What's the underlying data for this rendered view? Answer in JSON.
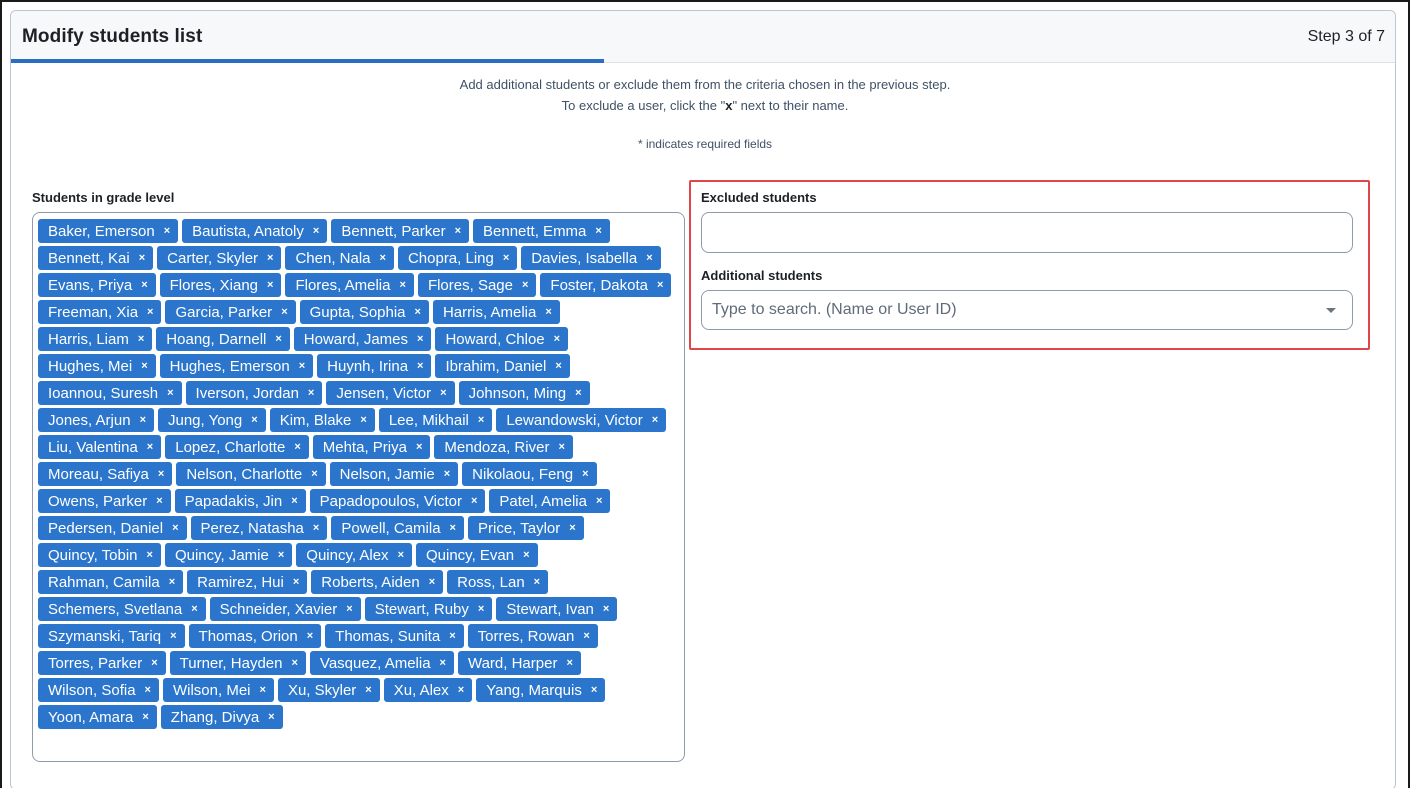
{
  "header": {
    "title": "Modify students list",
    "step": "Step 3 of 7"
  },
  "intro": {
    "line1": "Add additional students or exclude them from the criteria chosen in the previous step.",
    "line2_prefix": "To exclude a user, click the \"",
    "line2_bold": "x",
    "line2_suffix": "\" next to their name.",
    "required_note": "* indicates required fields"
  },
  "grade_level": {
    "label": "Students in grade level",
    "remove_symbol": "×",
    "students": [
      "Baker, Emerson",
      "Bautista, Anatoly",
      "Bennett, Parker",
      "Bennett, Emma",
      "Bennett, Kai",
      "Carter, Skyler",
      "Chen, Nala",
      "Chopra, Ling",
      "Davies, Isabella",
      "Evans, Priya",
      "Flores, Xiang",
      "Flores, Amelia",
      "Flores, Sage",
      "Foster, Dakota",
      "Freeman, Xia",
      "Garcia, Parker",
      "Gupta, Sophia",
      "Harris, Amelia",
      "Harris, Liam",
      "Hoang, Darnell",
      "Howard, James",
      "Howard, Chloe",
      "Hughes, Mei",
      "Hughes, Emerson",
      "Huynh, Irina",
      "Ibrahim, Daniel",
      "Ioannou, Suresh",
      "Iverson, Jordan",
      "Jensen, Victor",
      "Johnson, Ming",
      "Jones, Arjun",
      "Jung, Yong",
      "Kim, Blake",
      "Lee, Mikhail",
      "Lewandowski, Victor",
      "Liu, Valentina",
      "Lopez, Charlotte",
      "Mehta, Priya",
      "Mendoza, River",
      "Moreau, Safiya",
      "Nelson, Charlotte",
      "Nelson, Jamie",
      "Nikolaou, Feng",
      "Owens, Parker",
      "Papadakis, Jin",
      "Papadopoulos, Victor",
      "Patel, Amelia",
      "Pedersen, Daniel",
      "Perez, Natasha",
      "Powell, Camila",
      "Price, Taylor",
      "Quincy, Tobin",
      "Quincy, Jamie",
      "Quincy, Alex",
      "Quincy, Evan",
      "Rahman, Camila",
      "Ramirez, Hui",
      "Roberts, Aiden",
      "Ross, Lan",
      "Schemers, Svetlana",
      "Schneider, Xavier",
      "Stewart, Ruby",
      "Stewart, Ivan",
      "Szymanski, Tariq",
      "Thomas, Orion",
      "Thomas, Sunita",
      "Torres, Rowan",
      "Torres, Parker",
      "Turner, Hayden",
      "Vasquez, Amelia",
      "Ward, Harper",
      "Wilson, Sofia",
      "Wilson, Mei",
      "Xu, Skyler",
      "Xu, Alex",
      "Yang, Marquis",
      "Yoon, Amara",
      "Zhang, Divya"
    ]
  },
  "excluded": {
    "label": "Excluded students",
    "value": ""
  },
  "additional": {
    "label": "Additional students",
    "placeholder": "Type to search. (Name or User ID)",
    "value": ""
  },
  "colors": {
    "accent": "#2b76cc",
    "highlight": "#e0454a"
  }
}
